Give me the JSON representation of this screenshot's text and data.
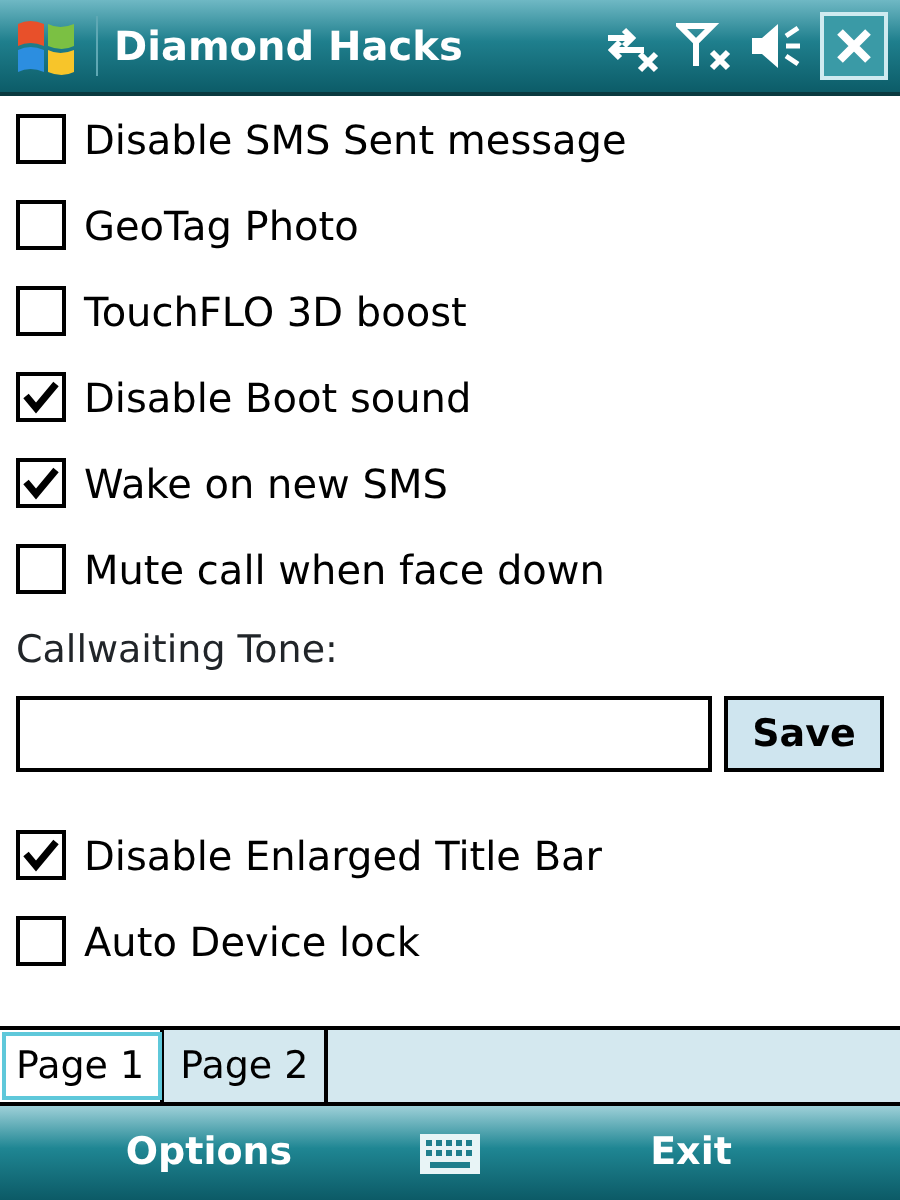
{
  "window": {
    "title": "Diamond Hacks"
  },
  "items": [
    {
      "kind": "checkbox",
      "label": "Disable SMS Sent message",
      "checked": false
    },
    {
      "kind": "checkbox",
      "label": "GeoTag Photo",
      "checked": false
    },
    {
      "kind": "checkbox",
      "label": "TouchFLO 3D boost",
      "checked": false
    },
    {
      "kind": "checkbox",
      "label": "Disable Boot sound",
      "checked": true
    },
    {
      "kind": "checkbox",
      "label": "Wake on new SMS",
      "checked": true
    },
    {
      "kind": "checkbox",
      "label": "Mute call when face down",
      "checked": false
    },
    {
      "kind": "label",
      "label": "Callwaiting Tone:"
    },
    {
      "kind": "input",
      "button": "Save"
    },
    {
      "kind": "checkbox",
      "label": "Disable Enlarged Title Bar",
      "checked": true
    },
    {
      "kind": "checkbox",
      "label": "Auto Device lock",
      "checked": false
    }
  ],
  "tabs": [
    {
      "label": "Page 1",
      "selected": true
    },
    {
      "label": "Page 2",
      "selected": false
    }
  ],
  "softkeys": {
    "left": "Options",
    "right": "Exit"
  }
}
